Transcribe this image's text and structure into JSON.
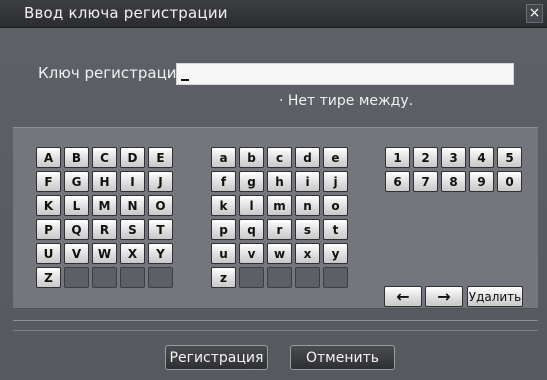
{
  "dialog": {
    "title": "Ввод ключа регистрации",
    "close_glyph": "×"
  },
  "form": {
    "key_label": "Ключ регистрации",
    "key_value": "",
    "hint": "· Нет тире между."
  },
  "keyboard": {
    "uppercase": [
      "A",
      "B",
      "C",
      "D",
      "E",
      "F",
      "G",
      "H",
      "I",
      "J",
      "K",
      "L",
      "M",
      "N",
      "O",
      "P",
      "Q",
      "R",
      "S",
      "T",
      "U",
      "V",
      "W",
      "X",
      "Y",
      "Z",
      "",
      "",
      "",
      ""
    ],
    "lowercase": [
      "a",
      "b",
      "c",
      "d",
      "e",
      "f",
      "g",
      "h",
      "i",
      "j",
      "k",
      "l",
      "m",
      "n",
      "o",
      "p",
      "q",
      "r",
      "s",
      "t",
      "u",
      "v",
      "w",
      "x",
      "y",
      "z",
      "",
      "",
      "",
      ""
    ],
    "digits": [
      "1",
      "2",
      "3",
      "4",
      "5",
      "6",
      "7",
      "8",
      "9",
      "0"
    ],
    "left_arrow": "←",
    "right_arrow": "→",
    "delete_label": "Удалить"
  },
  "buttons": {
    "register": "Регистрация",
    "cancel": "Отменить"
  },
  "icons": {
    "close": "close-icon",
    "left": "left-arrow-icon",
    "right": "right-arrow-icon"
  }
}
